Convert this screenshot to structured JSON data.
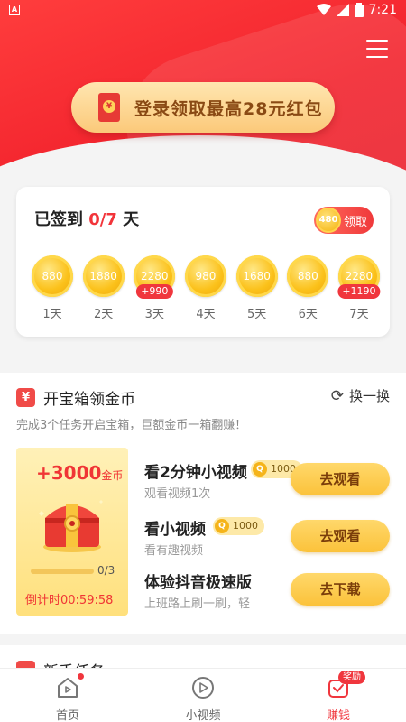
{
  "status_bar": {
    "left_badge": "A",
    "time": "7:21",
    "battery": "7"
  },
  "header": {
    "menu_icon": "hamburger-menu-icon"
  },
  "login_banner": {
    "text": "登录领取最高28元红包",
    "icon": "red-envelope-icon"
  },
  "signin": {
    "title_prefix": "已签到 ",
    "progress": "0/7",
    "title_suffix": " 天",
    "claim_coin": "480",
    "claim_label": "领取",
    "days": [
      {
        "coins": "880",
        "label": "1天",
        "bonus": ""
      },
      {
        "coins": "1880",
        "label": "2天",
        "bonus": ""
      },
      {
        "coins": "2280",
        "label": "3天",
        "bonus": "+990"
      },
      {
        "coins": "980",
        "label": "4天",
        "bonus": ""
      },
      {
        "coins": "1680",
        "label": "5天",
        "bonus": ""
      },
      {
        "coins": "880",
        "label": "6天",
        "bonus": ""
      },
      {
        "coins": "2280",
        "label": "7天",
        "bonus": "+1190"
      }
    ]
  },
  "treasure": {
    "icon_text": "¥",
    "title": "开宝箱领金币",
    "refresh_label": "换一换",
    "subtitle": "完成3个任务开启宝箱，巨额金币一箱翻赚！",
    "amount": "+3000",
    "amount_unit": "金币",
    "progress_text": "0/3",
    "progress_fraction": 0,
    "countdown": "倒计时00:59:58",
    "tasks": [
      {
        "name": "看2分钟小视频",
        "reward": "1000",
        "desc": "观看视频1次",
        "button": "去观看"
      },
      {
        "name": "看小视频",
        "reward": "1000",
        "desc": "看有趣视频",
        "button": "去观看"
      },
      {
        "name": "体验抖音极速版",
        "reward": "",
        "desc": "上班路上刷一刷，轻",
        "button": "去下载"
      }
    ]
  },
  "newbie": {
    "title": "新手任务"
  },
  "bottom_nav": [
    {
      "label": "首页",
      "icon": "home-icon",
      "active": false
    },
    {
      "label": "小视频",
      "icon": "play-circle-icon",
      "active": false
    },
    {
      "label": "赚钱",
      "icon": "earn-icon",
      "active": true,
      "badge": "奖励"
    }
  ],
  "colors": {
    "primary_red": "#f2232d",
    "gold": "#fbc23a",
    "banner_text": "#8a4a14"
  }
}
